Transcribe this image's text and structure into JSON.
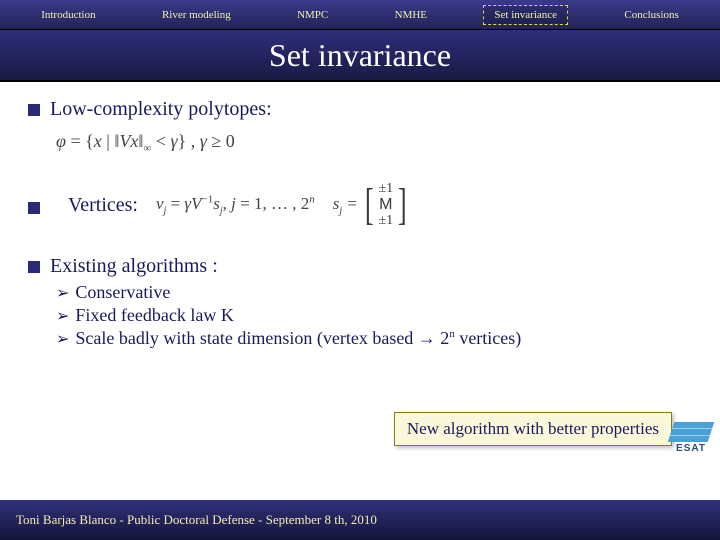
{
  "nav": {
    "items": [
      {
        "label": "Introduction",
        "active": false
      },
      {
        "label": "River modeling",
        "active": false
      },
      {
        "label": "NMPC",
        "active": false
      },
      {
        "label": "NMHE",
        "active": false
      },
      {
        "label": "Set invariance",
        "active": true
      },
      {
        "label": "Conclusions",
        "active": false
      }
    ]
  },
  "title": "Set invariance",
  "content": {
    "polytopes": {
      "label": "Low-complexity polytopes:",
      "formula": "φ = { x | ‖Vx‖∞ < γ } , γ ≥ 0"
    },
    "vertices": {
      "label": "Vertices:",
      "formula": "v_j = γ V⁻¹ s_j ,  j = 1, … , 2ⁿ",
      "matrix_lhs": "s_j =",
      "matrix_rows": [
        "±1",
        "M",
        "±1"
      ]
    },
    "existing": {
      "label": "Existing algorithms :",
      "items": [
        "Conservative",
        "Fixed feedback law K",
        "Scale badly with state dimension (vertex based → 2ⁿ vertices)"
      ]
    },
    "callout": "New algorithm with better properties"
  },
  "footer": {
    "text": "Toni Barjas Blanco - Public Doctoral Defense - September 8 th, 2010"
  },
  "logo": {
    "text": "ESAT"
  }
}
